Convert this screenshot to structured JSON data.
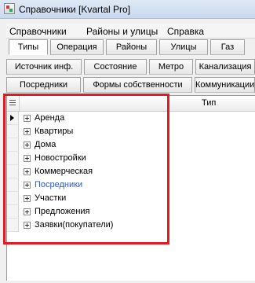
{
  "window": {
    "title": "Справочники [Kvartal Pro]"
  },
  "menu": [
    "Справочники",
    "Районы и улицы",
    "Справка"
  ],
  "tabs_row1": [
    "Типы",
    "Операция",
    "Районы",
    "Улицы",
    "Газ"
  ],
  "tabs_row2": [
    "Источник инф.",
    "Состояние",
    "Метро",
    "Канализация"
  ],
  "tabs_row3": [
    "Посредники",
    "Формы собственности",
    "Коммуникации"
  ],
  "grid": {
    "column_header": "Тип",
    "rows": [
      "Аренда",
      "Квартиры",
      "Дома",
      "Новостройки",
      "Коммерческая",
      "Посредники",
      "Участки",
      "Предложения",
      "Заявки(покупатели)"
    ]
  },
  "colors": {
    "highlight": "#e21a22",
    "link": "#2b58c4"
  }
}
